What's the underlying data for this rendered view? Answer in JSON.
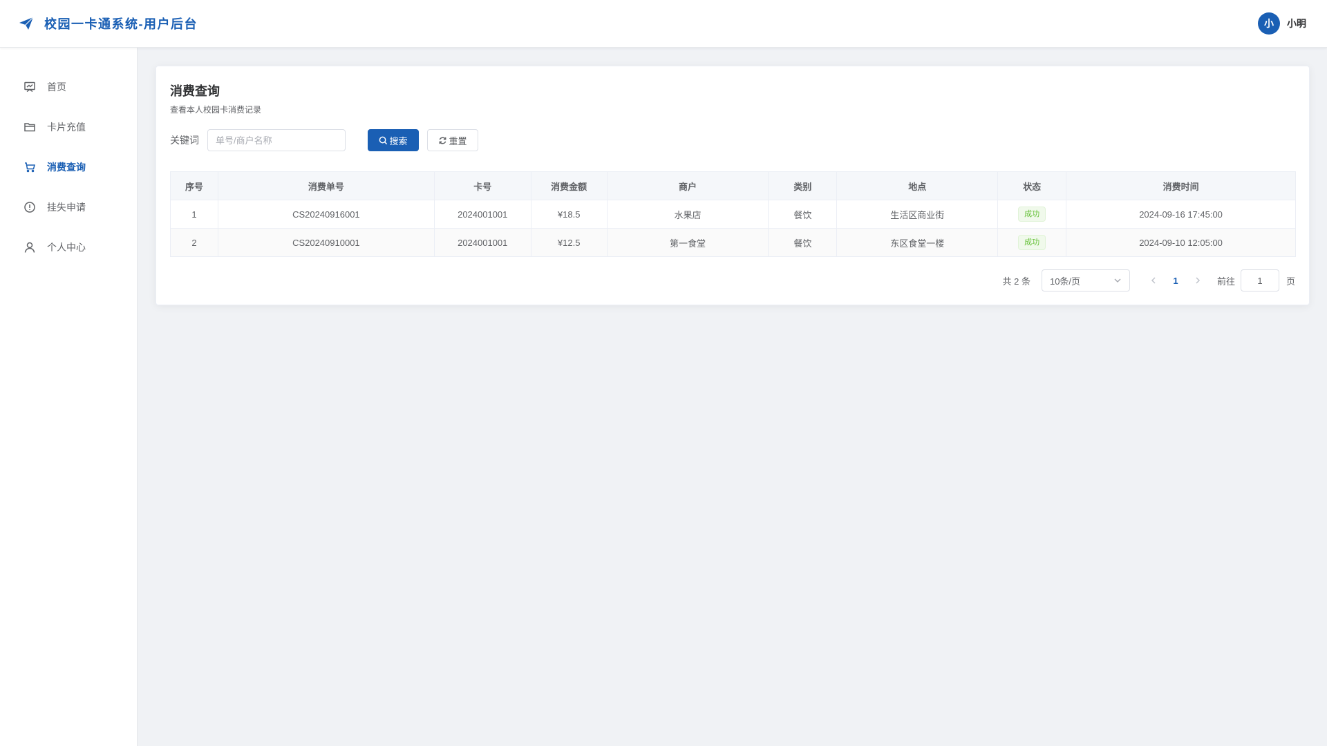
{
  "header": {
    "title": "校园一卡通系统-用户后台",
    "avatar_text": "小",
    "username": "小明",
    "brand_color": "#1a5fb4"
  },
  "sidebar": {
    "items": [
      {
        "label": "首页",
        "icon": "dashboard-icon"
      },
      {
        "label": "卡片充值",
        "icon": "folder-icon"
      },
      {
        "label": "消费查询",
        "icon": "cart-icon",
        "active": true
      },
      {
        "label": "挂失申请",
        "icon": "warning-circle-icon"
      },
      {
        "label": "个人中心",
        "icon": "user-icon"
      }
    ]
  },
  "main": {
    "title": "消费查询",
    "subtitle": "查看本人校园卡消费记录",
    "search": {
      "label": "关键词",
      "placeholder": "单号/商户名称",
      "value": "",
      "search_button": "搜索",
      "reset_button": "重置"
    },
    "table": {
      "columns": [
        "序号",
        "消费单号",
        "卡号",
        "消费金额",
        "商户",
        "类别",
        "地点",
        "状态",
        "消费时间"
      ],
      "rows": [
        {
          "index": "1",
          "order_no": "CS20240916001",
          "card_no": "2024001001",
          "amount": "¥18.5",
          "merchant": "水果店",
          "category": "餐饮",
          "location": "生活区商业街",
          "status": "成功",
          "time": "2024-09-16 17:45:00"
        },
        {
          "index": "2",
          "order_no": "CS20240910001",
          "card_no": "2024001001",
          "amount": "¥12.5",
          "merchant": "第一食堂",
          "category": "餐饮",
          "location": "东区食堂一楼",
          "status": "成功",
          "time": "2024-09-10 12:05:00"
        }
      ]
    },
    "pagination": {
      "total": "共 2 条",
      "page_size": "10条/页",
      "current_page": "1",
      "goto_label": "前往",
      "goto_value": "1",
      "page_suffix": "页"
    }
  }
}
